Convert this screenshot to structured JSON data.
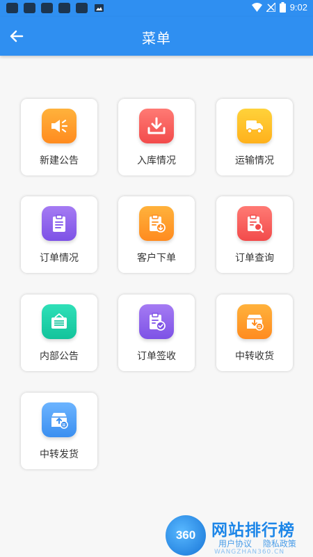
{
  "status_bar": {
    "time": "9:02"
  },
  "app_bar": {
    "title": "菜单"
  },
  "menu": {
    "items": [
      {
        "label": "新建公告",
        "icon": "megaphone-icon",
        "color_from": "#ffb23c",
        "color_to": "#ff8b1f"
      },
      {
        "label": "入库情况",
        "icon": "download-tray-icon",
        "color_from": "#ff7a74",
        "color_to": "#f24b4b"
      },
      {
        "label": "运输情况",
        "icon": "truck-icon",
        "color_from": "#ffd23a",
        "color_to": "#ffb11c"
      },
      {
        "label": "订单情况",
        "icon": "clipboard-list-icon",
        "color_from": "#a57bf3",
        "color_to": "#7d52e6"
      },
      {
        "label": "客户下单",
        "icon": "clipboard-download-icon",
        "color_from": "#ffb23c",
        "color_to": "#ff8b1f"
      },
      {
        "label": "订单查询",
        "icon": "clipboard-search-icon",
        "color_from": "#ff7a74",
        "color_to": "#f24b4b"
      },
      {
        "label": "内部公告",
        "icon": "notice-board-icon",
        "color_from": "#2fe0b8",
        "color_to": "#13c39b"
      },
      {
        "label": "订单签收",
        "icon": "clipboard-check-icon",
        "color_from": "#a57bf3",
        "color_to": "#7d52e6"
      },
      {
        "label": "中转收货",
        "icon": "box-receive-icon",
        "color_from": "#ffb23c",
        "color_to": "#ff8b1f"
      },
      {
        "label": "中转发货",
        "icon": "box-send-icon",
        "color_from": "#6cb4ff",
        "color_to": "#3b8ff0"
      }
    ]
  },
  "watermark": {
    "logo_text": "360",
    "title": "网站排行榜",
    "links": [
      "用户协议",
      "隐私政策"
    ],
    "url_text": "WANGZHAN360.CN"
  }
}
